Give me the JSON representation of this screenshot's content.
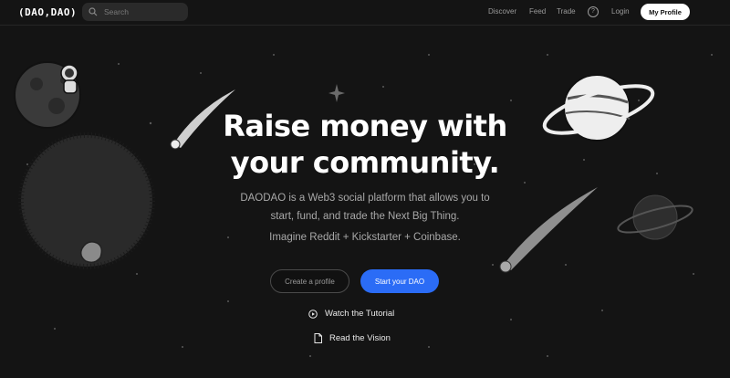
{
  "header": {
    "logo": "(DAO,DAO)",
    "search_placeholder": "Search",
    "nav": [
      "Discover",
      "Feed",
      "Trade"
    ],
    "help_label": "?",
    "login": "Login",
    "profile_button": "My Profile"
  },
  "hero": {
    "title_line1": "Raise money with",
    "title_line2": "your community.",
    "description_line1": "DAODAO is a Web3 social platform that allows you to",
    "description_line2": "start, fund, and trade the Next Big Thing.",
    "tagline": "Imagine Reddit + Kickstarter + Coinbase.",
    "create_profile": "Create a profile",
    "start_dao": "Start your DAO",
    "watch_tutorial": "Watch the Tutorial",
    "read_vision": "Read the Vision"
  },
  "colors": {
    "background": "#141414",
    "primary_button": "#2b6cf6"
  }
}
